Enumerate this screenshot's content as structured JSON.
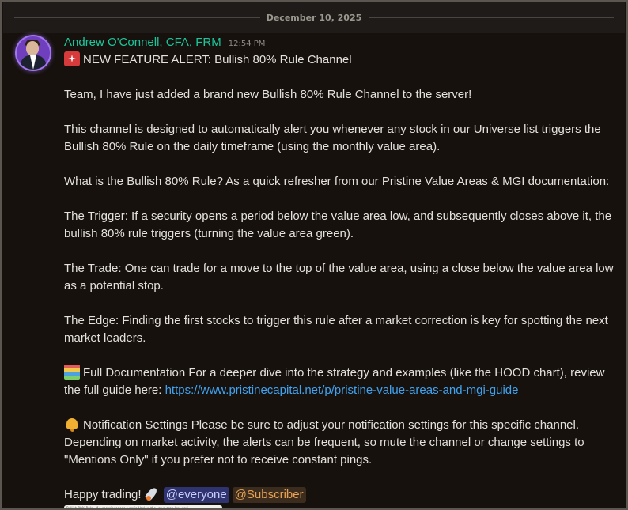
{
  "divider": {
    "date": "December 10, 2025"
  },
  "message": {
    "author": "Andrew O'Connell, CFA, FRM",
    "timestamp": "12:54 PM",
    "headline": "NEW FEATURE ALERT: Bullish 80% Rule Channel",
    "intro": "Team, I have just added a brand new Bullish 80% Rule Channel to the server!",
    "purpose": "This channel is designed to automatically alert you whenever any stock in our Universe list triggers the Bullish 80% Rule on the daily timeframe (using the monthly value area).",
    "question": "What is the Bullish 80% Rule? As a quick refresher from our Pristine Value Areas & MGI documentation:",
    "trigger": "The Trigger: If a security opens a period below the value area low, and subsequently closes above it, the bullish 80% rule triggers (turning the value area green).",
    "trade": "The Trade: One can trade for a move to the top of the value area, using a close below the value area low as a potential stop.",
    "edge": "The Edge: Finding the first stocks to trigger this rule after a market correction is key for spotting the next market leaders.",
    "docs_text": "Full Documentation For a deeper dive into the strategy and examples (like the HOOD chart), review the full guide here: ",
    "docs_link": "https://www.pristinecapital.net/p/pristine-value-areas-and-mgi-guide",
    "notify_text": "Notification Settings Please be sure to adjust your notification settings for this specific channel. Depending on market activity, the alerts can be frequent, so mute the channel or change settings to \"Mentions Only\" if you prefer not to receive constant pings.",
    "closing": "Happy trading!",
    "mention_everyone": "@everyone",
    "mention_role": "@Subscriber"
  },
  "attachment": {
    "caption": "Bullish 80% Rule - If a security opens a period below the value area low, and"
  },
  "icons": {
    "headline": "rotating-light-emoji",
    "docs": "books-emoji",
    "notify": "bell-emoji",
    "closing": "rocket-emoji"
  },
  "colors": {
    "author": "#1ac79c",
    "link": "#3fa3f2",
    "mention_everyone_bg": "#2f3370",
    "mention_role_fg": "#e7a254"
  }
}
